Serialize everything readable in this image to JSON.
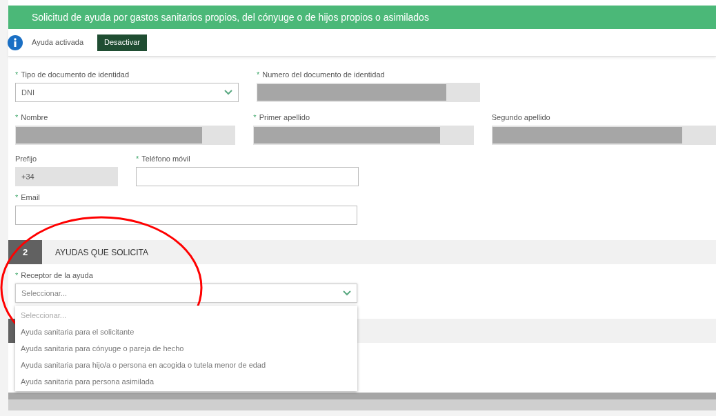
{
  "header": {
    "title": "Solicitud de ayuda por gastos sanitarios propios, del cónyuge o de hijos propios o asimilados"
  },
  "status": {
    "text": "Ayuda activada",
    "button": "Desactivar"
  },
  "rows": [
    [
      {
        "mark": "*",
        "label": "Tipo de documento de identidad",
        "kind": "select",
        "value": "DNI"
      },
      {
        "mark": "*",
        "label": "Numero del documento de identidad",
        "kind": "masked"
      }
    ],
    [
      {
        "mark": "*",
        "label": "Nombre",
        "kind": "masked"
      },
      {
        "mark": "*",
        "label": "Primer apellido",
        "kind": "masked"
      },
      {
        "label": "Segundo apellido",
        "kind": "masked"
      }
    ]
  ],
  "phone": {
    "prefix": {
      "label": "Prefijo",
      "value": "+34"
    },
    "mobile": {
      "mark": "*",
      "label": "Teléfono móvil"
    }
  },
  "email": {
    "mark": "*",
    "label": "Email"
  },
  "section": {
    "number": "2",
    "title": "AYUDAS QUE SOLICITA"
  },
  "receptor": {
    "mark": "*",
    "label": "Receptor de la ayuda",
    "placeholder": "Seleccionar...",
    "expanded": true,
    "options": [
      {
        "label": "Seleccionar...",
        "kind": "placeholder",
        "selected": false
      },
      {
        "label": "Ayuda sanitaria para el solicitante",
        "kind": "option",
        "selected": false
      },
      {
        "label": "Ayuda sanitaria para cónyuge o pareja de hecho",
        "kind": "option",
        "selected": false
      },
      {
        "label": "Ayuda sanitaria para hijo/a o persona en acogida o tutela menor de edad",
        "kind": "option",
        "selected": false
      },
      {
        "label": "Ayuda sanitaria para persona asimilada",
        "kind": "option",
        "selected": false
      }
    ]
  }
}
